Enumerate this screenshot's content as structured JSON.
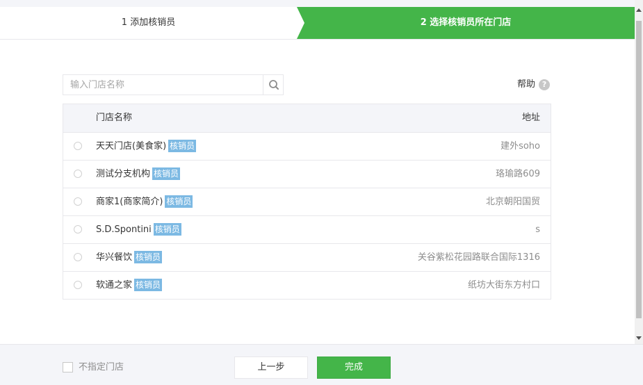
{
  "steps": {
    "step1_label": "1 添加核销员",
    "step2_label": "2 选择核销员所在门店"
  },
  "search": {
    "placeholder": "输入门店名称",
    "value": "",
    "icon": "search-icon"
  },
  "help": {
    "label": "帮助",
    "icon": "?"
  },
  "table": {
    "col_name": "门店名称",
    "col_address": "地址",
    "rows": [
      {
        "name": "天天门店(美食家)",
        "badge": "核销员",
        "address": "建外soho"
      },
      {
        "name": "测试分支机构",
        "badge": "核销员",
        "address": "珞瑜路609"
      },
      {
        "name": "商家1(商家简介)",
        "badge": "核销员",
        "address": "北京朝阳国贸"
      },
      {
        "name": "S.D.Spontini",
        "badge": "核销员",
        "address": "s"
      },
      {
        "name": "华兴餐饮",
        "badge": "核销员",
        "address": "关谷紫松花园路联合国际1316"
      },
      {
        "name": "软通之家",
        "badge": "核销员",
        "address": "纸坊大街东方村口"
      }
    ]
  },
  "footer": {
    "no_store_label": "不指定门店",
    "prev_label": "上一步",
    "done_label": "完成"
  },
  "colors": {
    "accent": "#44b549",
    "badge": "#7cb9e3",
    "header_bg": "#f4f5f9",
    "border": "#e7e7eb"
  }
}
